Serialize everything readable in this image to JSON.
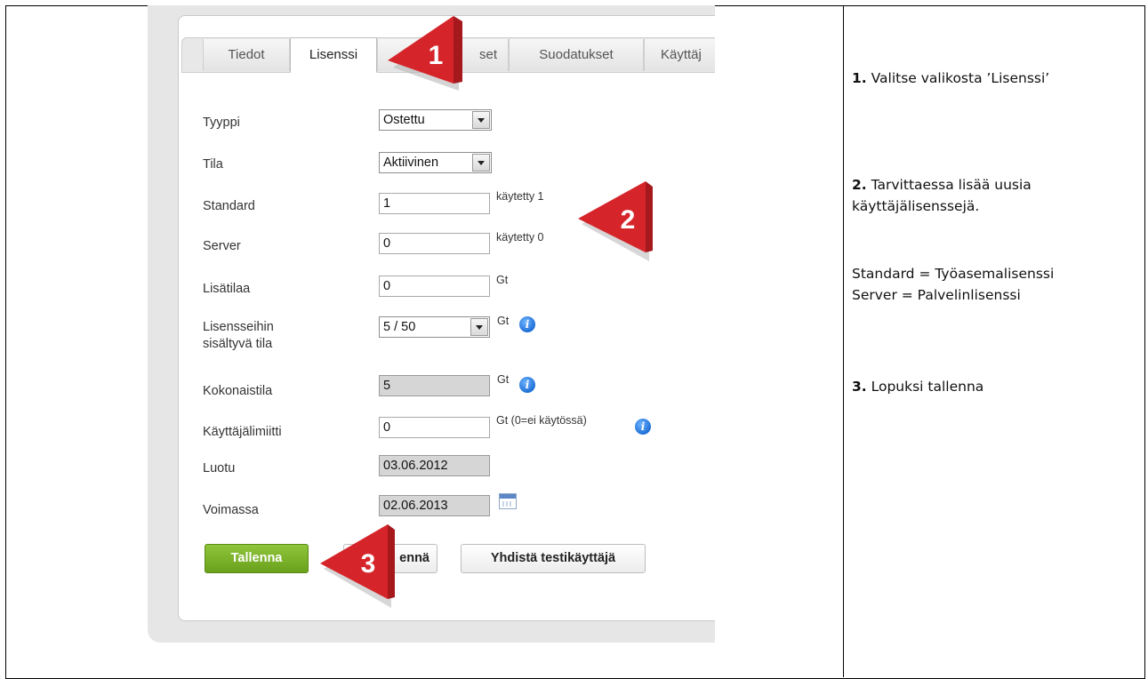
{
  "tabs": [
    "Tiedot",
    "Lisenssi",
    "Asetukset",
    "Suodatukset",
    "Käyttäj"
  ],
  "tab_visible": [
    "Tiedot",
    "Lisenssi",
    "set",
    "Suodatukset",
    "Käyttäj"
  ],
  "form": {
    "tyyppi": {
      "label": "Tyyppi",
      "value": "Ostettu"
    },
    "tila": {
      "label": "Tila",
      "value": "Aktiivinen"
    },
    "standard": {
      "label": "Standard",
      "value": "1",
      "hint": "käytetty 1"
    },
    "server": {
      "label": "Server",
      "value": "0",
      "hint": "käytetty 0"
    },
    "lisatilaa": {
      "label": "Lisätilaa",
      "value": "0",
      "hint": "Gt"
    },
    "sisaltyva": {
      "label_line1": "Lisensseihin",
      "label_line2": "sisältyvä tila",
      "value": "5 / 50",
      "hint": "Gt"
    },
    "kokonaistila": {
      "label": "Kokonaistila",
      "value": "5",
      "hint": "Gt"
    },
    "kayttajalimiitti": {
      "label": "Käyttäjälimiitti",
      "value": "0",
      "hint": "Gt (0=ei käytössä)"
    },
    "luotu": {
      "label": "Luotu",
      "value": "03.06.2012"
    },
    "voimassa": {
      "label": "Voimassa",
      "value": "02.06.2013"
    }
  },
  "buttons": {
    "save": "Tallenna",
    "cancel_visible": "ennä",
    "test": "Yhdistä testikäyttäjä"
  },
  "callouts": [
    "1",
    "2",
    "3"
  ],
  "instructions": {
    "step1_num": "1.",
    "step1_text": " Valitse valikosta ’Lisenssi’",
    "step2_num": "2.",
    "step2_text_line1": " Tarvittaessa lisää uusia",
    "step2_text_line2": "käyttäjälisenssejä.",
    "legend_line1": "Standard = Työasemalisenssi",
    "legend_line2": "Server = Palvelinlisenssi",
    "step3_num": "3.",
    "step3_text": " Lopuksi tallenna"
  },
  "colors": {
    "accent_green": "#7ab52a",
    "callout_red": "#d6252a",
    "info_blue": "#1e6fd6"
  }
}
